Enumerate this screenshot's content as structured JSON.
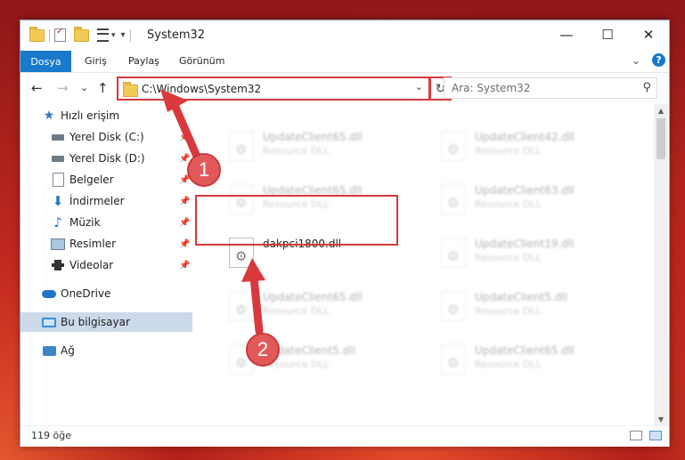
{
  "window": {
    "title": "System32",
    "controls": {
      "minimize": "—",
      "maximize": "☐",
      "close": "✕"
    }
  },
  "ribbon": {
    "tabs": [
      {
        "label": "Dosya"
      },
      {
        "label": "Giriş"
      },
      {
        "label": "Paylaş"
      },
      {
        "label": "Görünüm"
      }
    ],
    "expand_glyph": "⌄",
    "help_glyph": "?"
  },
  "address_bar": {
    "path": "C:\\Windows\\System32",
    "dropdown_glyph": "⌄",
    "refresh_glyph": "↻",
    "back_glyph": "←",
    "forward_glyph": "→",
    "recent_glyph": "⌄",
    "up_glyph": "↑"
  },
  "search": {
    "placeholder": "Ara: System32",
    "icon_glyph": "⚲"
  },
  "nav": {
    "quick_access": "Hızlı erişim",
    "items": [
      {
        "label": "Yerel Disk (C:)"
      },
      {
        "label": "Yerel Disk (D:)"
      },
      {
        "label": "Belgeler"
      },
      {
        "label": "İndirmeler"
      },
      {
        "label": "Müzik"
      },
      {
        "label": "Resimler"
      },
      {
        "label": "Videolar"
      }
    ],
    "onedrive": "OneDrive",
    "this_pc": "Bu bilgisayar",
    "network": "Ağ"
  },
  "files": {
    "left": [
      {
        "name": "UpdateClient65.dll",
        "type": "Resource DLL"
      },
      {
        "name": "UpdateClient65.dll",
        "type": "Resource DLL"
      },
      {
        "name": "dakpci1800.dll",
        "type": ""
      },
      {
        "name": "UpdateClient65.dll",
        "type": "Resource DLL"
      },
      {
        "name": "UpdateClient5.dll",
        "type": "Resource DLL"
      }
    ],
    "right": [
      {
        "name": "UpdateClient42.dll",
        "type": "Resource DLL"
      },
      {
        "name": "UpdateClient63.dll",
        "type": "Resource DLL"
      },
      {
        "name": "UpdateClient19.dll",
        "type": "Resource DLL"
      },
      {
        "name": "UpdateClient5.dll",
        "type": "Resource DLL"
      },
      {
        "name": "UpdateClient65.dll",
        "type": "Resource DLL"
      }
    ]
  },
  "status": {
    "item_count": "119 öğe"
  },
  "annotations": {
    "step1": "1",
    "step2": "2",
    "color": "#d9393c"
  }
}
